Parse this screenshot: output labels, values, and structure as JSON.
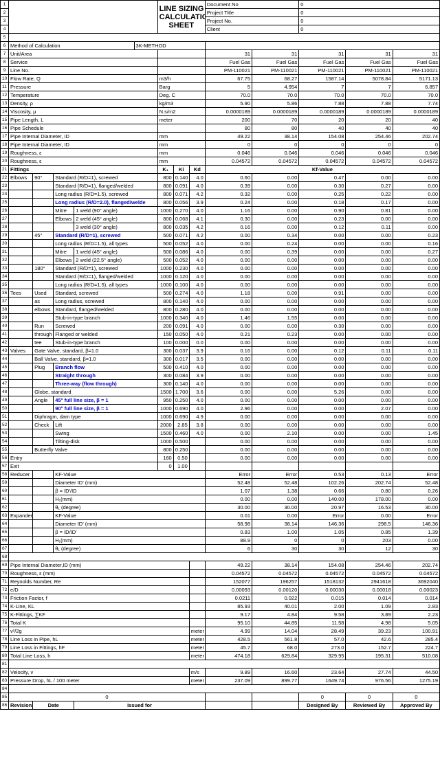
{
  "title1": "LINE SIZING",
  "title2": "CALCULATION",
  "title3": "SHEET",
  "doc": {
    "docno": "Document No",
    "docno_v": "0",
    "proj": "Project Title",
    "proj_v": "0",
    "projno": "Project No.",
    "projno_v": "0",
    "client": "Client",
    "client_v": "0"
  },
  "r6": {
    "a": "Method of Calculation",
    "b": "3K-METHOD"
  },
  "r7": {
    "a": "Unit/Area",
    "v": [
      "31",
      "31",
      "31",
      "31",
      "31"
    ]
  },
  "r8": {
    "a": "Service",
    "v": [
      "Fuel Gas",
      "Fuel Gas",
      "Fuel Gas",
      "Fuel Gas",
      "Fuel Gas"
    ]
  },
  "r9": {
    "a": "Line No.",
    "v": [
      "PM-110021",
      "PM-110021",
      "PM-110021",
      "PM-110021",
      "PM-110021"
    ]
  },
  "r10": {
    "a": "Flow Rate, Q",
    "u": "m3/h",
    "v": [
      "67.75",
      "68.27",
      "1587.14",
      "5078.84",
      "5171.13"
    ]
  },
  "r11": {
    "a": "Pressure",
    "u": "Barg",
    "v": [
      "5",
      "4.954",
      "7",
      "7",
      "6.857"
    ]
  },
  "r12": {
    "a": "Temperature",
    "u": "Deg. C",
    "v": [
      "70.0",
      "70.0",
      "70.0",
      "70.0",
      "70.0"
    ]
  },
  "r13": {
    "a": "Density, ρ",
    "u": "kg/m3",
    "v": [
      "5.90",
      "5.86",
      "7.88",
      "7.88",
      "7.74"
    ]
  },
  "r14": {
    "a": "Viscosity, μ",
    "u": "N.s/m2",
    "v": [
      "0.0000189",
      "0.0000189",
      "0.0000189",
      "0.0000189",
      "0.0000189"
    ]
  },
  "r15": {
    "a": "Pipe Length, L",
    "u": "meter",
    "v": [
      "200",
      "70",
      "20",
      "20",
      "40"
    ]
  },
  "r16": {
    "a": "Pipe Schedule",
    "v": [
      "80",
      "80",
      "40",
      "40",
      "40"
    ]
  },
  "r17": {
    "a": "Pipe Internal Diameter, ID",
    "u": "mm",
    "v": [
      "49.22",
      "38.14",
      "154.08",
      "254.46",
      "202.74"
    ]
  },
  "r18": {
    "a": "Pipe Internal Diameter, ID",
    "u": "mm",
    "v": [
      "0",
      "0",
      "0",
      "0",
      "0"
    ]
  },
  "r19": {
    "a": "Roughness, ε",
    "u": "mm",
    "v": [
      "0.046",
      "0.046",
      "0.046",
      "0.046",
      "0.046"
    ]
  },
  "r20": {
    "a": "Roughness, ε",
    "u": "mm",
    "v": [
      "0.04572",
      "0.04572",
      "0.04572",
      "0.04572",
      "0.04572"
    ]
  },
  "r21": {
    "a": "Fittings",
    "k1": "K₁",
    "ki": "Ki",
    "kd": "Kd",
    "kf": "Kf-Value"
  },
  "fit": [
    {
      "n": 22,
      "c": [
        "Elbows",
        "90°",
        "Standard (R/D=1), screwed"
      ],
      "k": [
        "800",
        "0.140",
        "4.0"
      ],
      "v": [
        "0.60",
        "0.00",
        "0.47",
        "0.00",
        "0.00"
      ]
    },
    {
      "n": 23,
      "c": [
        "",
        "",
        "Standard (R/D=1), flanged/welded"
      ],
      "k": [
        "800",
        "0.091",
        "4.0"
      ],
      "v": [
        "0.39",
        "0.00",
        "0.30",
        "0.27",
        "0.00"
      ]
    },
    {
      "n": 24,
      "c": [
        "",
        "",
        "Long radius (R/D=1.5), screwed"
      ],
      "k": [
        "800",
        "0.071",
        "4.2"
      ],
      "v": [
        "0.32",
        "0.00",
        "0.25",
        "0.22",
        "0.00"
      ]
    },
    {
      "n": 25,
      "c": [
        "",
        "",
        "Long radius (R/D=2.0), flanged/welde"
      ],
      "k": [
        "800",
        "0.056",
        "3.9"
      ],
      "v": [
        "0.24",
        "0.00",
        "0.18",
        "0.17",
        "0.00"
      ],
      "bl": 2
    },
    {
      "n": 26,
      "c": [
        "",
        "",
        "Mitre",
        "1 weld (90° angle)"
      ],
      "k": [
        "1000",
        "0.270",
        "4.0"
      ],
      "v": [
        "1.16",
        "0.00",
        "0.90",
        "0.81",
        "0.00"
      ]
    },
    {
      "n": 27,
      "c": [
        "",
        "",
        "Elbows",
        "2 weld (45° angle)"
      ],
      "k": [
        "800",
        "0.068",
        "4.1"
      ],
      "v": [
        "0.30",
        "0.00",
        "0.23",
        "0.00",
        "0.00"
      ]
    },
    {
      "n": 28,
      "c": [
        "",
        "",
        "",
        "3 weld (30° angle)"
      ],
      "k": [
        "800",
        "0.035",
        "4.2"
      ],
      "v": [
        "0.16",
        "0.00",
        "0.12",
        "0.11",
        "0.00"
      ]
    },
    {
      "n": 29,
      "c": [
        "",
        "45°",
        "Standard (R/D=1), screwed"
      ],
      "k": [
        "500",
        "0.071",
        "4.2"
      ],
      "v": [
        "0.00",
        "0.34",
        "0.00",
        "0.00",
        "0.23"
      ],
      "bl": 2
    },
    {
      "n": 30,
      "c": [
        "",
        "",
        "Long radius (R/D=1.5), all types"
      ],
      "k": [
        "500",
        "0.052",
        "4.0"
      ],
      "v": [
        "0.00",
        "0.24",
        "0.00",
        "0.00",
        "0.16"
      ]
    },
    {
      "n": 31,
      "c": [
        "",
        "",
        "Mitre",
        "1 weld (45° angle)"
      ],
      "k": [
        "500",
        "0.086",
        "4.0"
      ],
      "v": [
        "0.00",
        "0.39",
        "0.00",
        "0.00",
        "0.27"
      ]
    },
    {
      "n": 32,
      "c": [
        "",
        "",
        "Elbows",
        "2 weld (22.5° angle)"
      ],
      "k": [
        "500",
        "0.052",
        "4.0"
      ],
      "v": [
        "0.00",
        "0.00",
        "0.00",
        "0.00",
        "0.00"
      ]
    },
    {
      "n": 33,
      "c": [
        "",
        "180°",
        "Standard (R/D=1), screwed"
      ],
      "k": [
        "1000",
        "0.230",
        "4.0"
      ],
      "v": [
        "0.00",
        "0.00",
        "0.00",
        "0.00",
        "0.00"
      ]
    },
    {
      "n": 34,
      "c": [
        "",
        "",
        "Standard (R/D=1), flanged/welded"
      ],
      "k": [
        "1000",
        "0.120",
        "4.0"
      ],
      "v": [
        "0.00",
        "0.00",
        "0.00",
        "0.00",
        "0.00"
      ]
    },
    {
      "n": 35,
      "c": [
        "",
        "",
        "Long radius (R/D=1.5), all types"
      ],
      "k": [
        "1000",
        "0.100",
        "4.0"
      ],
      "v": [
        "0.00",
        "0.00",
        "0.00",
        "0.00",
        "0.00"
      ]
    },
    {
      "n": 36,
      "c": [
        "Tees",
        "Used",
        "Standard, screwed"
      ],
      "k": [
        "500",
        "0.274",
        "4.0"
      ],
      "v": [
        "1.18",
        "0.00",
        "0.91",
        "0.00",
        "0.00"
      ]
    },
    {
      "n": 37,
      "c": [
        "",
        "as",
        "Long radius, screwed"
      ],
      "k": [
        "800",
        "0.140",
        "4.0"
      ],
      "v": [
        "0.00",
        "0.00",
        "0.00",
        "0.00",
        "0.00"
      ]
    },
    {
      "n": 38,
      "c": [
        "",
        "elbows",
        "Standard, flanged/welded"
      ],
      "k": [
        "800",
        "0.280",
        "4.0"
      ],
      "v": [
        "0.00",
        "0.00",
        "0.00",
        "0.00",
        "0.00"
      ]
    },
    {
      "n": 39,
      "c": [
        "",
        "",
        "Stub-in-type branch"
      ],
      "k": [
        "1000",
        "0.340",
        "4.0"
      ],
      "v": [
        "1.46",
        "1.55",
        "0.00",
        "0.00",
        "0.00"
      ]
    },
    {
      "n": 40,
      "c": [
        "",
        "Run",
        "Screwed"
      ],
      "k": [
        "200",
        "0.091",
        "4.0"
      ],
      "v": [
        "0.00",
        "0.00",
        "0.30",
        "0.00",
        "0.00"
      ]
    },
    {
      "n": 41,
      "c": [
        "",
        "through",
        "Flanged or welded"
      ],
      "k": [
        "150",
        "0.050",
        "4.0"
      ],
      "v": [
        "0.21",
        "0.23",
        "0.00",
        "0.00",
        "0.00"
      ]
    },
    {
      "n": 42,
      "c": [
        "",
        "tee",
        "Stub-in-type branch"
      ],
      "k": [
        "100",
        "0.000",
        "0.0"
      ],
      "v": [
        "0.00",
        "0.00",
        "0.00",
        "0.00",
        "0.00"
      ]
    },
    {
      "n": 43,
      "c": [
        "Valves",
        "Gate Valve, standard, β=1.0"
      ],
      "k": [
        "300",
        "0.037",
        "3.9"
      ],
      "v": [
        "0.16",
        "0.00",
        "0.12",
        "0.11",
        "0.11"
      ]
    },
    {
      "n": 44,
      "c": [
        "",
        "Ball Valve, standard, β=1.0"
      ],
      "k": [
        "300",
        "0.017",
        "3.5"
      ],
      "v": [
        "0.00",
        "0.00",
        "0.00",
        "0.00",
        "0.00"
      ]
    },
    {
      "n": 45,
      "c": [
        "",
        "Plug",
        "Branch flow"
      ],
      "k": [
        "500",
        "0.410",
        "4.0"
      ],
      "v": [
        "0.00",
        "0.00",
        "0.00",
        "0.00",
        "0.00"
      ],
      "bl": 2
    },
    {
      "n": 46,
      "c": [
        "",
        "",
        "Straight through"
      ],
      "k": [
        "300",
        "0.084",
        "3.9"
      ],
      "v": [
        "0.00",
        "0.00",
        "0.00",
        "0.00",
        "0.00"
      ],
      "bl": 2
    },
    {
      "n": 47,
      "c": [
        "",
        "",
        "Three-way (flow through)"
      ],
      "k": [
        "300",
        "0.140",
        "4.0"
      ],
      "v": [
        "0.00",
        "0.00",
        "0.00",
        "0.00",
        "0.00"
      ],
      "bl": 2
    },
    {
      "n": 48,
      "c": [
        "",
        "Globe, standard"
      ],
      "k": [
        "1500",
        "1.700",
        "3.6"
      ],
      "v": [
        "0.00",
        "0.00",
        "5.26",
        "0.00",
        "0.00"
      ]
    },
    {
      "n": 49,
      "c": [
        "",
        "Angle",
        "45°  full line size, β = 1"
      ],
      "k": [
        "950",
        "0.250",
        "4.0"
      ],
      "v": [
        "0.00",
        "0.00",
        "0.00",
        "0.00",
        "0.00"
      ],
      "bl": 2
    },
    {
      "n": 50,
      "c": [
        "",
        "",
        "90°  full line size, β = 1"
      ],
      "k": [
        "1000",
        "0.690",
        "4.0"
      ],
      "v": [
        "2.96",
        "0.00",
        "0.00",
        "2.07",
        "0.00"
      ],
      "bl": 2
    },
    {
      "n": 51,
      "c": [
        "",
        "Diphragm, dam type"
      ],
      "k": [
        "1000",
        "0.690",
        "4.9"
      ],
      "v": [
        "0.00",
        "0.00",
        "0.00",
        "0.00",
        "0.00"
      ]
    },
    {
      "n": 52,
      "c": [
        "",
        "Check",
        "Lift"
      ],
      "k": [
        "2000",
        "2.85",
        "3.8"
      ],
      "v": [
        "0.00",
        "0.00",
        "0.00",
        "0.00",
        "0.00"
      ]
    },
    {
      "n": 53,
      "c": [
        "",
        "",
        "Swing"
      ],
      "k": [
        "1500",
        "0.460",
        "4.0"
      ],
      "v": [
        "0.00",
        "2.10",
        "0.00",
        "0.00",
        "1.45"
      ]
    },
    {
      "n": 54,
      "c": [
        "",
        "",
        "Tilting-disk"
      ],
      "k": [
        "1000",
        "0.500",
        ""
      ],
      "v": [
        "0.00",
        "0.00",
        "0.00",
        "0.00",
        "0.00"
      ]
    },
    {
      "n": 55,
      "c": [
        "",
        "Butterfly Valve"
      ],
      "k": [
        "800",
        "0.250",
        ""
      ],
      "v": [
        "0.00",
        "0.00",
        "0.00",
        "0.00",
        "0.00"
      ]
    },
    {
      "n": 56,
      "c": [
        "Entry"
      ],
      "k": [
        "160",
        "0.50",
        ""
      ],
      "v": [
        "0.00",
        "0.00",
        "0.00",
        "0.00",
        "0.00"
      ]
    },
    {
      "n": 57,
      "c": [
        "Exit"
      ],
      "k": [
        "0",
        "1.00",
        ""
      ],
      "v": [
        "",
        "",
        "",
        "",
        ""
      ]
    }
  ],
  "red": [
    {
      "n": 58,
      "a": "Reducer",
      "b": "KF-Value",
      "v": [
        "Error",
        "Error",
        "0.53",
        "0.13",
        "Error"
      ]
    },
    {
      "n": 59,
      "a": "",
      "b": "Diameter ID' (mm)",
      "v": [
        "52.48",
        "52.48",
        "102.26",
        "202.74",
        "52.48"
      ]
    },
    {
      "n": 60,
      "a": "",
      "b": "β = ID'/ID",
      "v": [
        "1.07",
        "1.38",
        "0.66",
        "0.80",
        "0.26"
      ]
    },
    {
      "n": 61,
      "a": "",
      "b": "H₁(mm)",
      "v": [
        "0.00",
        "0.00",
        "140.00",
        "178.00",
        "0.00"
      ]
    },
    {
      "n": 62,
      "a": "",
      "b": "θ₁ (degree)",
      "v": [
        "30.00",
        "30.00",
        "20.97",
        "16.53",
        "30.00"
      ]
    },
    {
      "n": 63,
      "a": "Expander",
      "b": "KF-Value",
      "v": [
        "0.01",
        "0.00",
        "Error",
        "0.00",
        "Error"
      ]
    },
    {
      "n": 64,
      "a": "",
      "b": "Diameter ID' (mm)",
      "v": [
        "58.98",
        "38.14",
        "146.36",
        "298.5",
        "146.36"
      ]
    },
    {
      "n": 65,
      "a": "",
      "b": "β = ID/ID'",
      "v": [
        "0.83",
        "1.00",
        "1.05",
        "0.85",
        "1.39"
      ]
    },
    {
      "n": 66,
      "a": "",
      "b": "H₁(mm)",
      "v": [
        "88.9",
        "0",
        "0",
        "203",
        "0.00"
      ]
    },
    {
      "n": 67,
      "a": "",
      "b": "θ₁ (degree)",
      "v": [
        "6",
        "30",
        "30",
        "12",
        "30"
      ]
    }
  ],
  "res": [
    {
      "n": 69,
      "a": "Pipe Internal Diameter,ID (mm)",
      "v": [
        "49.22",
        "38.14",
        "154.08",
        "254.46",
        "202.74"
      ]
    },
    {
      "n": 70,
      "a": "Roughness, ε (mm)",
      "v": [
        "0.04572",
        "0.04572",
        "0.04572",
        "0.04572",
        "0.04572"
      ]
    },
    {
      "n": 71,
      "a": "Reynolds Number, Re",
      "v": [
        "152077",
        "196257",
        "1518132",
        "2941618",
        "3692040"
      ]
    },
    {
      "n": 72,
      "a": "e/D",
      "v": [
        "0.00093",
        "0.00120",
        "0.00030",
        "0.00018",
        "0.00023"
      ]
    },
    {
      "n": 73,
      "a": "Friction Factor, f",
      "v": [
        "0.0211",
        "0.022",
        "0.015",
        "0.014",
        "0.014"
      ]
    },
    {
      "n": 74,
      "a": "K-Line, KL",
      "v": [
        "85.93",
        "40.01",
        "2.00",
        "1.09",
        "2.83"
      ]
    },
    {
      "n": 75,
      "a": "K-Fittings, ∑KF",
      "v": [
        "9.17",
        "4.84",
        "9.58",
        "3.89",
        "2.23"
      ]
    },
    {
      "n": 76,
      "a": "Total K",
      "v": [
        "95.10",
        "44.85",
        "11.58",
        "4.98",
        "5.05"
      ]
    },
    {
      "n": 77,
      "a": "v²/2g",
      "u": "meter",
      "v": [
        "4.99",
        "14.04",
        "28.49",
        "39.23",
        "100.91"
      ]
    },
    {
      "n": 78,
      "a": "Line Loss in Pipe, hL",
      "u": "meter",
      "v": [
        "428.5",
        "561.8",
        "57.0",
        "42.6",
        "285.4"
      ]
    },
    {
      "n": 79,
      "a": "Line Loss in Fittings, hF",
      "u": "meter",
      "v": [
        "45.7",
        "68.0",
        "273.0",
        "152.7",
        "224.7"
      ]
    },
    {
      "n": 80,
      "a": "Total Line Loss, h",
      "u": "meter",
      "v": [
        "474.18",
        "629.84",
        "329.95",
        "195.31",
        "510.08"
      ]
    }
  ],
  "vel": [
    {
      "n": 82,
      "a": "Velocity, v",
      "u": "m/s",
      "v": [
        "9.89",
        "16.60",
        "23.64",
        "27.74",
        "44.50"
      ]
    },
    {
      "n": 83,
      "a": "Pressure Drop, hL / 100 meter",
      "u": "meter",
      "v": [
        "237.09",
        "899.77",
        "1649.74",
        "976.56",
        "1275.19"
      ]
    }
  ],
  "foot": {
    "n85": "0",
    "z": "0",
    "rev": "Revision",
    "date": "Date",
    "iss": "Issued for",
    "des": "Designed By",
    "rvw": "Reviewed By",
    "app": "Approved By"
  }
}
